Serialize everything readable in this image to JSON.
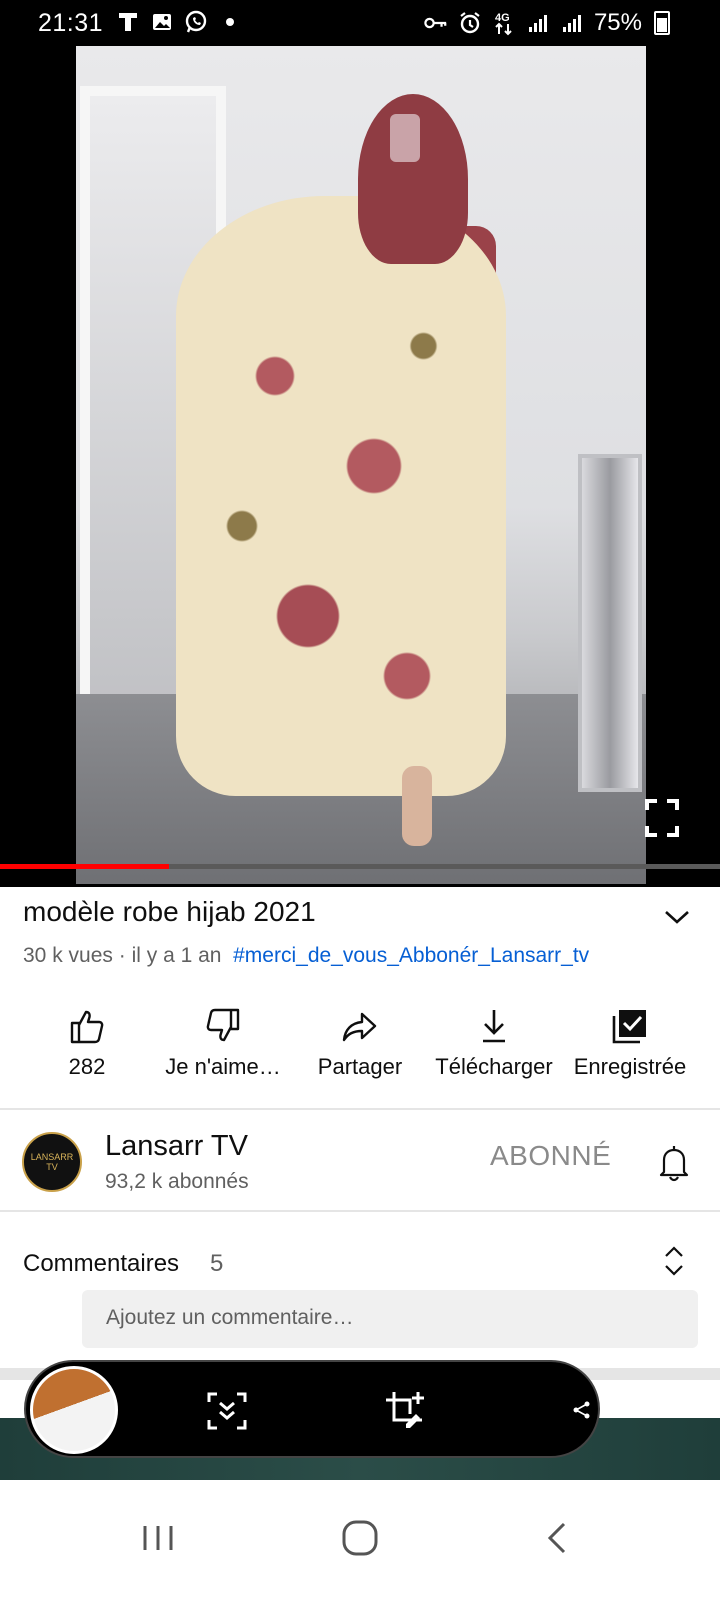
{
  "status_bar": {
    "time": "21:31",
    "battery_text": "75%",
    "left_icons": [
      "t-mobile-icon",
      "image-icon",
      "whatsapp-icon",
      "dot-icon"
    ],
    "right_icons": [
      "key-icon",
      "alarm-icon",
      "network-4g-icon",
      "signal-icon",
      "signal-icon",
      "battery-icon"
    ]
  },
  "player": {
    "progress": 0.235,
    "progress_color": "#ff0000"
  },
  "video": {
    "title": "modèle robe hijab 2021",
    "views": "30 k vues",
    "separator": " · ",
    "age": "il y a 1 an",
    "hashtag": "#merci_de_vous_Abbonér_Lansarr_tv",
    "hashtag_color": "#065fd4"
  },
  "actions": [
    {
      "label": "282",
      "icon": "thumbs-up-icon"
    },
    {
      "label": "Je n'aime…",
      "icon": "thumbs-down-icon"
    },
    {
      "label": "Partager",
      "icon": "share-icon"
    },
    {
      "label": "Télécharger",
      "icon": "download-icon"
    },
    {
      "label": "Enregistrée",
      "icon": "saved-playlist-icon"
    }
  ],
  "channel": {
    "name": "Lansarr TV",
    "subscribers": "93,2 k abonnés",
    "subscribe_state": "ABONNÉ",
    "avatar_text": "LANSARR TV"
  },
  "comments": {
    "label": "Commentaires",
    "count": "5",
    "placeholder": "Ajoutez un commentaire…"
  },
  "floating_bar": {
    "icons": [
      "screenshot-scroll-icon",
      "crop-edit-icon",
      "share-icon"
    ]
  },
  "nav_bar": {
    "buttons": [
      "recent-apps-icon",
      "home-icon",
      "back-icon"
    ]
  }
}
